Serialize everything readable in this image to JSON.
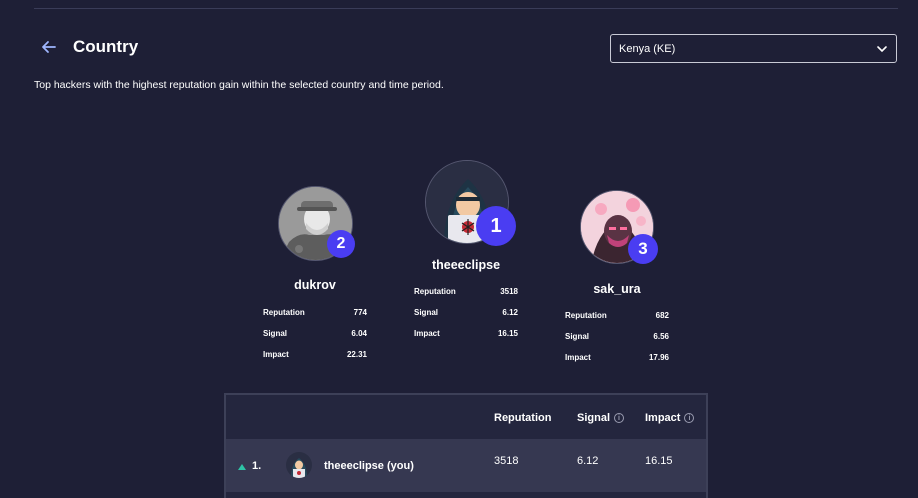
{
  "header": {
    "title": "Country",
    "subtitle": "Top hackers with the highest reputation gain within the selected country and time period."
  },
  "country_select": {
    "value": "Kenya (KE)"
  },
  "podium": [
    {
      "rank": "2",
      "name": "dukrov",
      "stats": [
        {
          "label": "Reputation",
          "value": "774"
        },
        {
          "label": "Signal",
          "value": "6.04"
        },
        {
          "label": "Impact",
          "value": "22.31"
        }
      ]
    },
    {
      "rank": "1",
      "name": "theeeclipse",
      "stats": [
        {
          "label": "Reputation",
          "value": "3518"
        },
        {
          "label": "Signal",
          "value": "6.12"
        },
        {
          "label": "Impact",
          "value": "16.15"
        }
      ]
    },
    {
      "rank": "3",
      "name": "sak_ura",
      "stats": [
        {
          "label": "Reputation",
          "value": "682"
        },
        {
          "label": "Signal",
          "value": "6.56"
        },
        {
          "label": "Impact",
          "value": "17.96"
        }
      ]
    }
  ],
  "table": {
    "columns": [
      "Reputation",
      "Signal",
      "Impact"
    ],
    "rows": [
      {
        "rank": "1.",
        "name": "theeeclipse (you)",
        "reputation": "3518",
        "signal": "6.12",
        "impact": "16.15"
      }
    ]
  },
  "colors": {
    "background": "#1e1f36",
    "accent": "#4a3df2",
    "trend_up": "#2ec4a6"
  },
  "icons": {
    "back": "arrow-left-icon",
    "select": "chevron-down-icon",
    "info": "info-icon",
    "trend": "triangle-up-icon"
  }
}
